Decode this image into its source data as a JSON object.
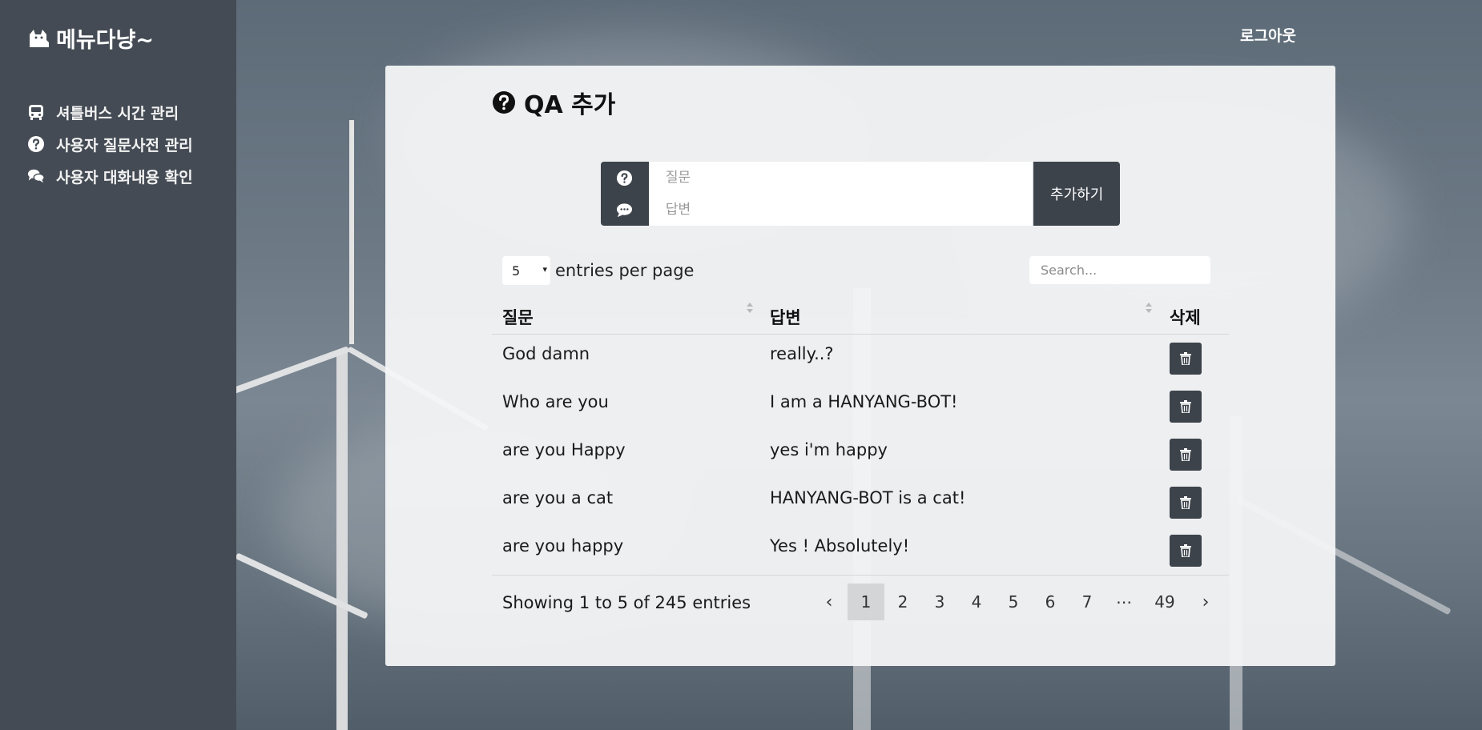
{
  "brand": {
    "name": "메뉴다냥~",
    "icon": "cat-icon"
  },
  "sidebar": {
    "items": [
      {
        "label": "셔틀버스 시간 관리",
        "icon": "bus-icon"
      },
      {
        "label": "사용자 질문사전 관리",
        "icon": "question-circle-icon"
      },
      {
        "label": "사용자 대화내용 확인",
        "icon": "comments-icon"
      }
    ]
  },
  "header": {
    "logout_label": "로그아웃"
  },
  "page": {
    "title": "QA 추가",
    "title_icon": "question-circle-icon"
  },
  "qa_form": {
    "question_placeholder": "질문",
    "answer_placeholder": "답변",
    "submit_label": "추가하기"
  },
  "table": {
    "per_page": {
      "value": "5",
      "label": "entries per page"
    },
    "search_placeholder": "Search...",
    "columns": [
      "질문",
      "답변",
      "삭제"
    ],
    "rows": [
      {
        "question": "God damn",
        "answer": "really..?"
      },
      {
        "question": "Who are you",
        "answer": "I am a HANYANG-BOT!"
      },
      {
        "question": "are you Happy",
        "answer": "yes i'm happy"
      },
      {
        "question": "are you a cat",
        "answer": "HANYANG-BOT is a cat!"
      },
      {
        "question": "are you happy",
        "answer": "Yes ! Absolutely!"
      }
    ],
    "info": "Showing 1 to 5 of 245 entries",
    "pagination": {
      "prev": "‹",
      "pages": [
        "1",
        "2",
        "3",
        "4",
        "5",
        "6",
        "7"
      ],
      "ellipsis": "⋯",
      "last": "49",
      "next": "›",
      "active": "1"
    }
  },
  "colors": {
    "sidebar_bg": "#444b54",
    "button_bg": "#3d434b",
    "card_bg": "#f3f4f5"
  }
}
